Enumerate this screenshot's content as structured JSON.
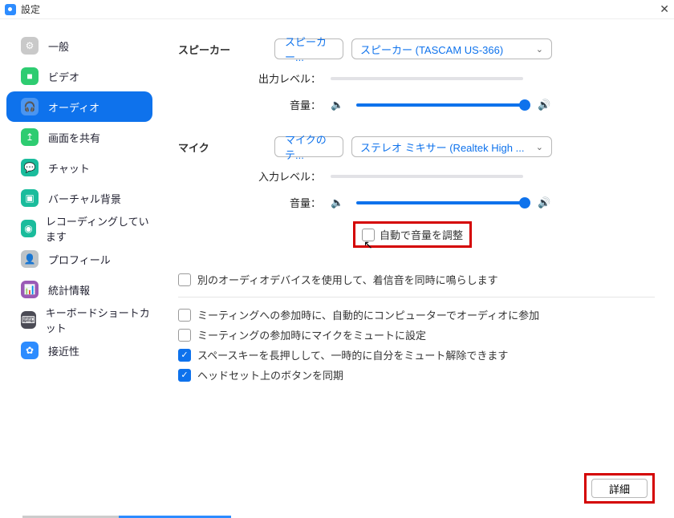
{
  "window": {
    "title": "設定",
    "close": "✕"
  },
  "sidebar": {
    "items": [
      {
        "label": "一般",
        "iconColor": "#c9c9c9",
        "glyph": "⚙"
      },
      {
        "label": "ビデオ",
        "iconColor": "#2ecc71",
        "glyph": "■"
      },
      {
        "label": "オーディオ",
        "iconColor": "#ffffff",
        "glyph": "🎧",
        "active": true
      },
      {
        "label": "画面を共有",
        "iconColor": "#2ecc71",
        "glyph": "↥"
      },
      {
        "label": "チャット",
        "iconColor": "#1abc9c",
        "glyph": "💬"
      },
      {
        "label": "バーチャル背景",
        "iconColor": "#1abc9c",
        "glyph": "▣"
      },
      {
        "label": "レコーディングしています",
        "iconColor": "#1abc9c",
        "glyph": "◉"
      },
      {
        "label": "プロフィール",
        "iconColor": "#bdc3c7",
        "glyph": "👤"
      },
      {
        "label": "統計情報",
        "iconColor": "#9b59b6",
        "glyph": "📊"
      },
      {
        "label": "キーボードショートカット",
        "iconColor": "#4b4b55",
        "glyph": "⌨"
      },
      {
        "label": "接近性",
        "iconColor": "#2D8CFF",
        "glyph": "✿"
      }
    ]
  },
  "speaker": {
    "label": "スピーカー",
    "testBtn": "スピーカー...",
    "device": "スピーカー (TASCAM US-366)",
    "outputLevel": "出力レベル：",
    "volume": "音量："
  },
  "mic": {
    "label": "マイク",
    "testBtn": "マイクのテ...",
    "device": "ステレオ ミキサー (Realtek High ...",
    "inputLevel": "入力レベル：",
    "volume": "音量：",
    "autoAdjust": "自動で音量を調整"
  },
  "options": {
    "ring": "別のオーディオデバイスを使用して、着信音を同時に鳴らします",
    "autoJoin": "ミーティングへの参加時に、自動的にコンピューターでオーディオに参加",
    "muteOnJoin": "ミーティングの参加時にマイクをミュートに設定",
    "spaceUnmute": "スペースキーを長押しして、一時的に自分をミュート解除できます",
    "headsetSync": "ヘッドセット上のボタンを同期"
  },
  "advanced": "詳細"
}
